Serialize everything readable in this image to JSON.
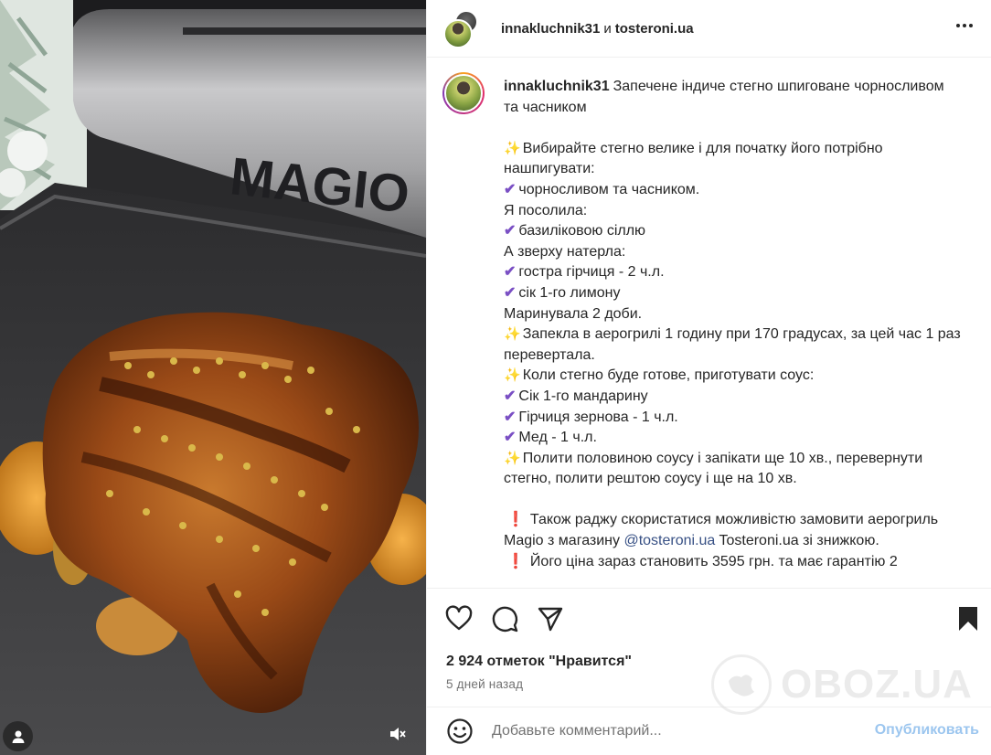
{
  "header": {
    "author": "innakluchnik31",
    "conjunction": "и",
    "collaborator": "tosteroni.ua"
  },
  "media": {
    "brand_text": "MAGIO",
    "user_icon": "user-icon",
    "mute_icon": "speaker-muted-icon"
  },
  "caption": {
    "username": "innakluchnik31",
    "intro": "Запечене індиче стегно шпиговане чорносливом та часником",
    "lines": [
      {
        "emoji": "sparkles",
        "text": "Вибирайте стегно велике і для початку його потрібно нашпигувати:"
      },
      {
        "emoji": "check",
        "text": "чорносливом та часником."
      },
      {
        "emoji": "",
        "text": "Я посолила:"
      },
      {
        "emoji": "check",
        "text": "базиліковою сіллю"
      },
      {
        "emoji": "",
        "text": "А зверху натерла:"
      },
      {
        "emoji": "check",
        "text": "гостра гірчиця - 2 ч.л."
      },
      {
        "emoji": "check",
        "text": "сік 1-го лимону"
      },
      {
        "emoji": "",
        "text": "Маринувала 2 доби."
      },
      {
        "emoji": "sparkles",
        "text": "Запекла в аерогрилі 1 годину при 170 градусах, за цей час 1 раз перевертала."
      },
      {
        "emoji": "sparkles",
        "text": "Коли стегно буде готове, приготувати соус:"
      },
      {
        "emoji": "check",
        "text": "Сік 1-го мандарину"
      },
      {
        "emoji": "check",
        "text": "Гірчиця зернова - 1 ч.л."
      },
      {
        "emoji": "check",
        "text": "Мед - 1 ч.л."
      },
      {
        "emoji": "sparkles",
        "text": "Полити половиною соусу і запікати ще 10 хв., перевернути стегно, полити рештою соусу і ще на 10 хв."
      }
    ],
    "promo_before": "Також раджу скористатися можливістю замовити аерогриль Magio з магазину",
    "promo_mention": "@tosteroni.ua",
    "promo_after": "Tosteroni.ua зі знижкою.",
    "price_line": "Його ціна зараз становить 3595 грн. та має гарантію 2"
  },
  "actions": {
    "like_icon": "heart-icon",
    "comment_icon": "comment-icon",
    "share_icon": "paper-plane-icon",
    "save_icon": "bookmark-icon",
    "likes_text": "2 924 отметок \"Нравится\"",
    "time_text": "5 дней назад"
  },
  "comment": {
    "emoji_icon": "smiley-icon",
    "placeholder": "Добавьте комментарий...",
    "publish_label": "Опубликовать"
  },
  "watermark": {
    "text": "OBOZ.UA"
  },
  "colors": {
    "link": "#385185",
    "publish_disabled": "#9cc6ef",
    "secondary_text": "#737373",
    "check_emoji": "#7a4fc4",
    "sparkle_emoji": "#f5b82e",
    "exclamation_emoji": "#e0334c"
  }
}
